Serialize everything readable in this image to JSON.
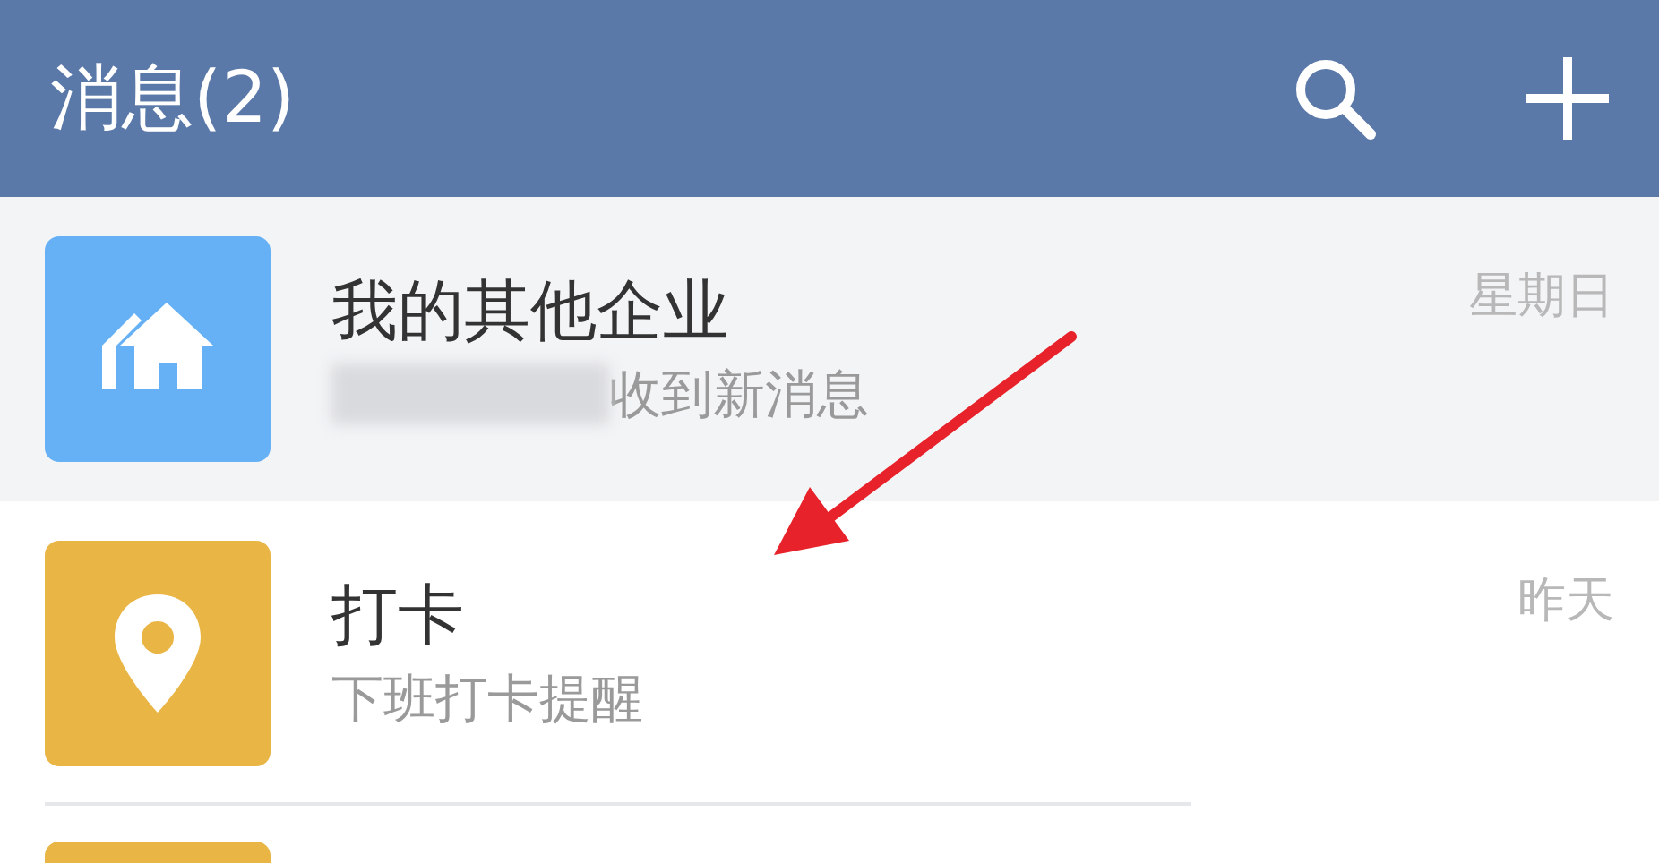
{
  "header": {
    "title": "消息(2)"
  },
  "chats": [
    {
      "kind": "home",
      "color": "#66b1f5",
      "pinned": true,
      "redacted": true,
      "title": "我的其他企业",
      "subtitle": "收到新消息",
      "time": "星期日"
    },
    {
      "kind": "location",
      "color": "#e9b544",
      "pinned": false,
      "redacted": false,
      "title": "打卡",
      "subtitle": "下班打卡提醒",
      "time": "昨天"
    },
    {
      "kind": "partial",
      "color": "#e9b544",
      "pinned": false
    }
  ]
}
